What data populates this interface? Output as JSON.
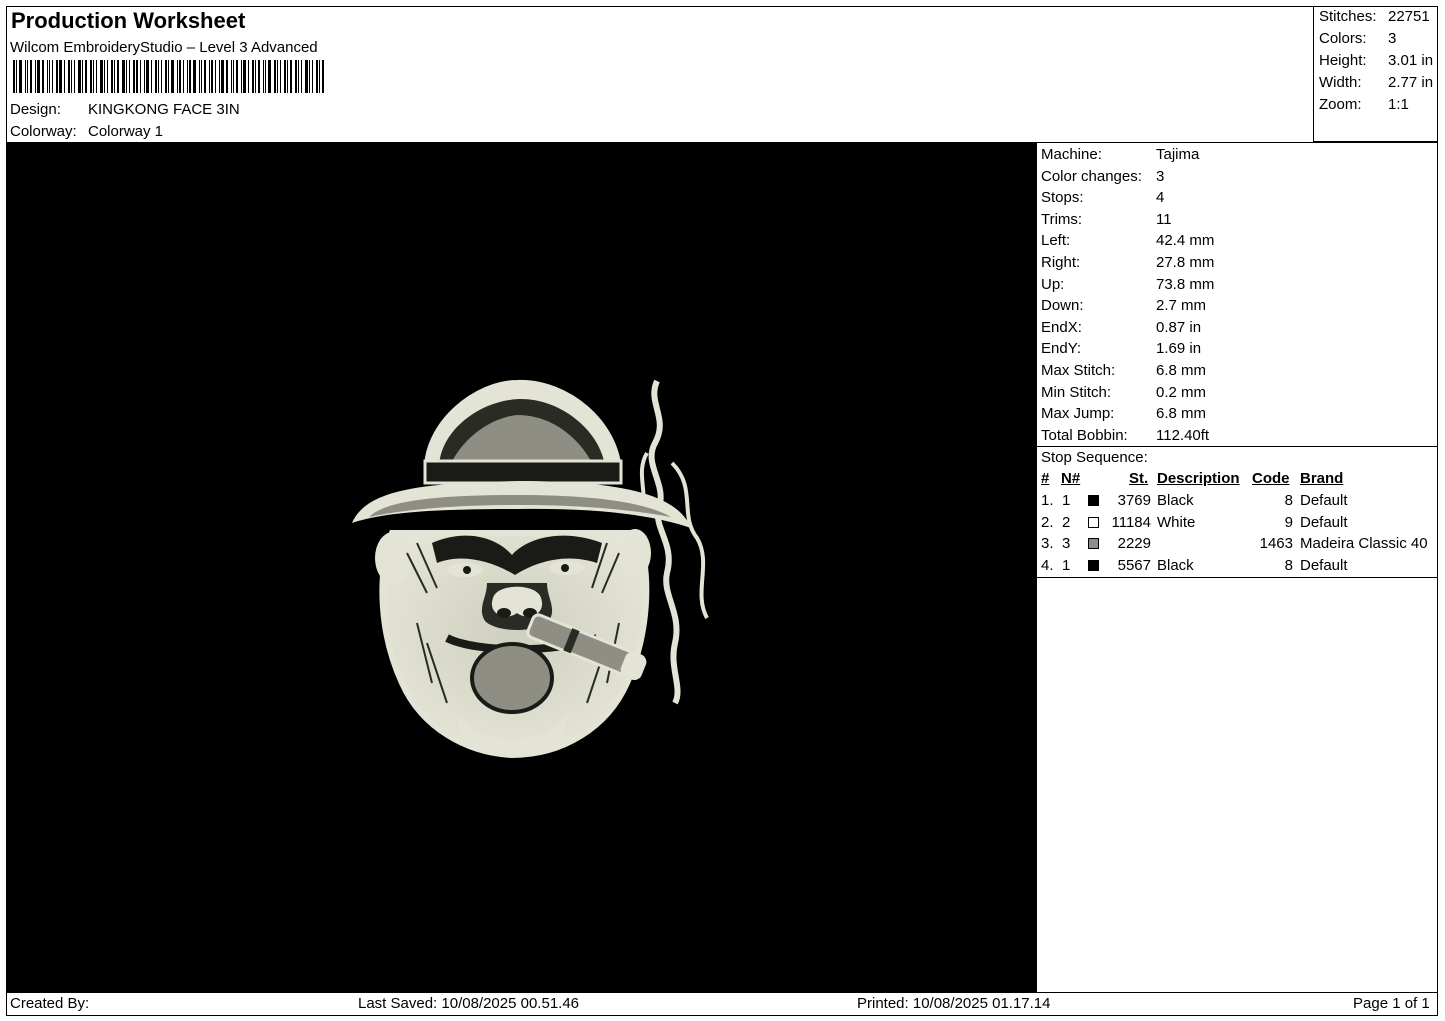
{
  "header": {
    "title": "Production Worksheet",
    "software": "Wilcom EmbroideryStudio – Level 3 Advanced",
    "design_label": "Design:",
    "design_value": "KINGKONG FACE 3IN",
    "colorway_label": "Colorway:",
    "colorway_value": "Colorway 1"
  },
  "summary": [
    {
      "label": "Stitches:",
      "value": "22751"
    },
    {
      "label": "Colors:",
      "value": "3"
    },
    {
      "label": "Height:",
      "value": "3.01 in"
    },
    {
      "label": "Width:",
      "value": "2.77 in"
    },
    {
      "label": "Zoom:",
      "value": "1:1"
    }
  ],
  "machine_info": [
    {
      "label": "Machine:",
      "value": "Tajima"
    },
    {
      "label": "Color changes:",
      "value": "3"
    },
    {
      "label": "Stops:",
      "value": "4"
    },
    {
      "label": "Trims:",
      "value": "11"
    },
    {
      "label": "Left:",
      "value": "42.4 mm"
    },
    {
      "label": "Right:",
      "value": "27.8 mm"
    },
    {
      "label": "Up:",
      "value": "73.8 mm"
    },
    {
      "label": "Down:",
      "value": "2.7 mm"
    },
    {
      "label": "EndX:",
      "value": "0.87 in"
    },
    {
      "label": "EndY:",
      "value": "1.69 in"
    },
    {
      "label": "Max Stitch:",
      "value": "6.8 mm"
    },
    {
      "label": "Min Stitch:",
      "value": "0.2 mm"
    },
    {
      "label": "Max Jump:",
      "value": "6.8 mm"
    },
    {
      "label": "Total Bobbin:",
      "value": "112.40ft"
    }
  ],
  "stop_sequence": {
    "title": "Stop Sequence:",
    "headers": {
      "num": "#",
      "n": "N#",
      "st": "St.",
      "description": "Description",
      "code": "Code",
      "brand": "Brand"
    },
    "rows": [
      {
        "num": "1.",
        "n": "1",
        "color": "#000000",
        "st": "3769",
        "description": "Black",
        "code": "8",
        "brand": "Default"
      },
      {
        "num": "2.",
        "n": "2",
        "color": "#ffffff",
        "st": "11184",
        "description": "White",
        "code": "9",
        "brand": "Default"
      },
      {
        "num": "3.",
        "n": "3",
        "color": "#8f8e84",
        "st": "2229",
        "description": "",
        "code": "1463",
        "brand": "Madeira Classic 40"
      },
      {
        "num": "4.",
        "n": "1",
        "color": "#000000",
        "st": "5567",
        "description": "Black",
        "code": "8",
        "brand": "Default"
      }
    ]
  },
  "footer": {
    "created_by": "Created By:",
    "last_saved": "Last Saved: 10/08/2025 00.51.46",
    "printed": "Printed: 10/08/2025 01.17.14",
    "page": "Page 1 of 1"
  },
  "design_colors": {
    "background": "#000000",
    "thread_light": "#e4e4d6",
    "thread_gray": "#8f8e84"
  }
}
